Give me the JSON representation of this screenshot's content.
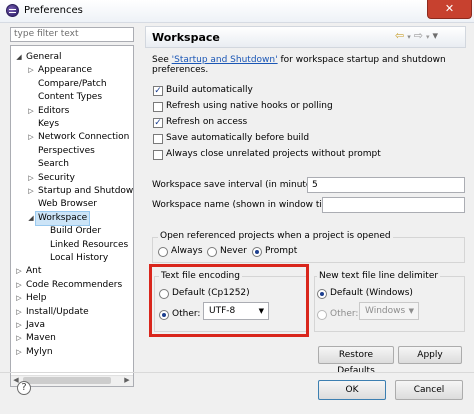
{
  "window": {
    "title": "Preferences",
    "close_glyph": "✕"
  },
  "filter": {
    "placeholder": "type filter text"
  },
  "tree": {
    "items": [
      {
        "label": "General",
        "expanded": true
      },
      {
        "label": "Appearance"
      },
      {
        "label": "Compare/Patch"
      },
      {
        "label": "Content Types"
      },
      {
        "label": "Editors"
      },
      {
        "label": "Keys"
      },
      {
        "label": "Network Connection"
      },
      {
        "label": "Perspectives"
      },
      {
        "label": "Search"
      },
      {
        "label": "Security"
      },
      {
        "label": "Startup and Shutdown"
      },
      {
        "label": "Web Browser"
      },
      {
        "label": "Workspace",
        "selected": true
      },
      {
        "label": "Build Order"
      },
      {
        "label": "Linked Resources"
      },
      {
        "label": "Local History"
      },
      {
        "label": "Ant"
      },
      {
        "label": "Code Recommenders"
      },
      {
        "label": "Help"
      },
      {
        "label": "Install/Update"
      },
      {
        "label": "Java"
      },
      {
        "label": "Maven"
      },
      {
        "label": "Mylyn"
      }
    ]
  },
  "page": {
    "title": "Workspace",
    "nav_back": "⇦",
    "nav_forward": "⇨",
    "nav_menu": "▾",
    "desc_prefix": "See ",
    "desc_link": "'Startup and Shutdown'",
    "desc_suffix": " for workspace startup and shutdown preferences.",
    "checkboxes": [
      {
        "label": "Build automatically",
        "checked": true
      },
      {
        "label": "Refresh using native hooks or polling",
        "checked": false
      },
      {
        "label": "Refresh on access",
        "checked": true
      },
      {
        "label": "Save automatically before build",
        "checked": false
      },
      {
        "label": "Always close unrelated projects without prompt",
        "checked": false
      }
    ],
    "save_interval_label": "Workspace save interval (in minutes):",
    "save_interval_value": "5",
    "workspace_name_label": "Workspace name (shown in window title):",
    "workspace_name_value": "",
    "open_projects": {
      "label": "Open referenced projects when a project is opened",
      "options": [
        "Always",
        "Never",
        "Prompt"
      ],
      "selected": "Prompt"
    },
    "encoding": {
      "label": "Text file encoding",
      "default_option": "Default (Cp1252)",
      "other_option": "Other:",
      "selected": "Other",
      "other_value": "UTF-8"
    },
    "line_delimiter": {
      "label": "New text file line delimiter",
      "default_option": "Default (Windows)",
      "other_option": "Other:",
      "selected": "Default",
      "other_value": "Windows"
    },
    "restore_defaults": "Restore Defaults",
    "apply": "Apply"
  },
  "footer": {
    "help_glyph": "?",
    "ok": "OK",
    "cancel": "Cancel"
  },
  "colors": {
    "highlight": "#d9261c",
    "selection": "#cce4f7",
    "link": "#1a56b5"
  }
}
